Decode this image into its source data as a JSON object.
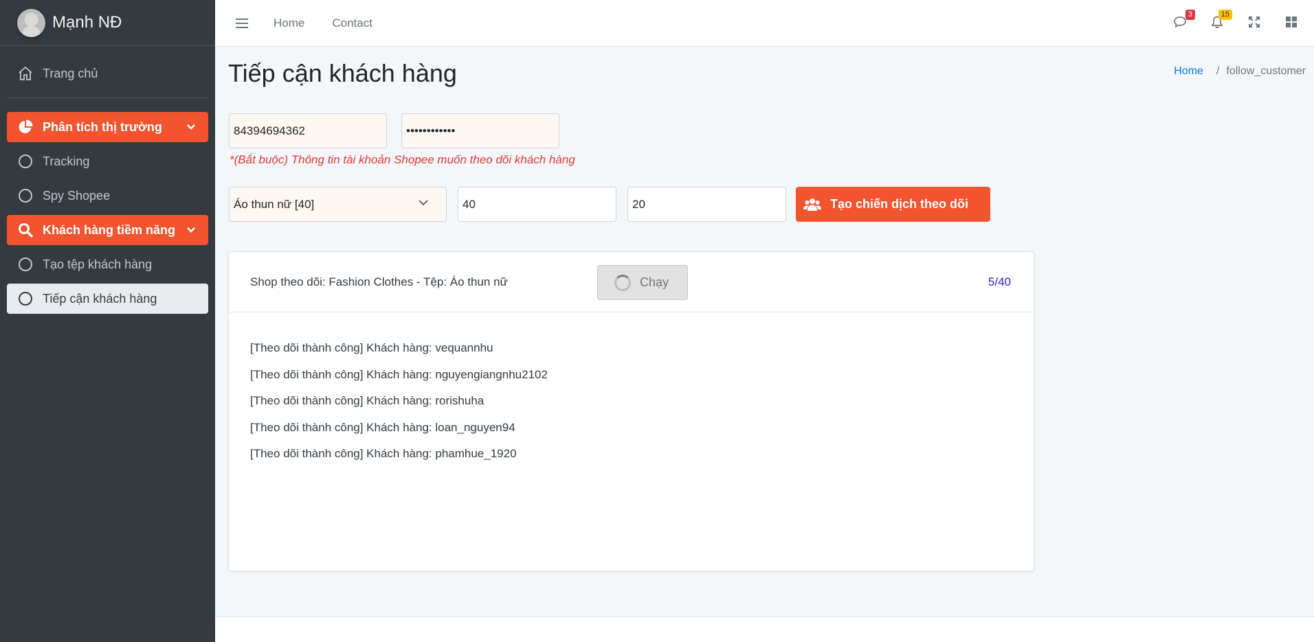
{
  "sidebar": {
    "user_name": "Mạnh NĐ",
    "home_label": "Trang chủ",
    "group1": {
      "label": "Phân tích thị trường",
      "items": [
        {
          "label": "Tracking"
        },
        {
          "label": "Spy Shopee"
        }
      ]
    },
    "group2": {
      "label": "Khách hàng tiềm năng",
      "items": [
        {
          "label": "Tạo tệp khách hàng"
        },
        {
          "label": "Tiếp cận khách hàng"
        }
      ]
    },
    "accent_color": "#f1542f"
  },
  "topbar": {
    "links": [
      "Home",
      "Contact"
    ],
    "messages_badge": "3",
    "notifications_badge": "15"
  },
  "page": {
    "title": "Tiếp cận khách hàng",
    "breadcrumb": {
      "home": "Home",
      "separator": "/",
      "current": "follow_customer"
    }
  },
  "form": {
    "account_value": "84394694362",
    "password_value": "••••••••••••",
    "required_note": "*(Bắt buộc) Thông tin tài khoản Shopee muốn theo dõi khách hàng",
    "category_selected": "Áo thun nữ [40]",
    "quantity_value": "40",
    "delay_value": "20",
    "submit_label": "Tạo chiến dịch theo dõi"
  },
  "campaign": {
    "title": "Shop theo dõi: Fashion Clothes - Tệp: Áo thun nữ",
    "run_label": "Chạy",
    "progress": "5/40",
    "logs": [
      "[Theo dõi thành công] Khách hàng: vequannhu",
      "[Theo dõi thành công] Khách hàng: nguyengiangnhu2102",
      "[Theo dõi thành công] Khách hàng: rorishuha",
      "[Theo dõi thành công] Khách hàng: loan_nguyen94",
      "[Theo dõi thành công] Khách hàng: phamhue_1920"
    ]
  }
}
